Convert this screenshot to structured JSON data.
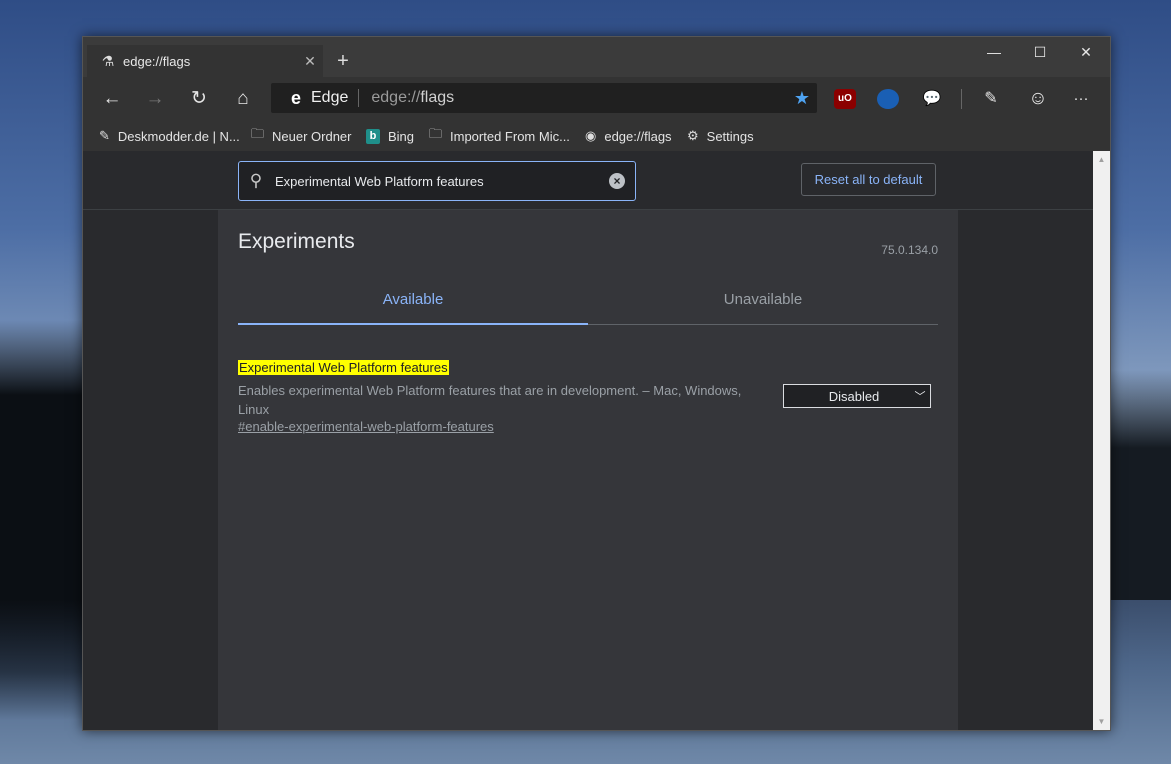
{
  "tab": {
    "title": "edge://flags",
    "close": "✕",
    "new_tab": "+"
  },
  "window_controls": {
    "minimize": "—",
    "maximize": "☐",
    "close": "✕"
  },
  "toolbar": {
    "back": "←",
    "forward": "→",
    "refresh": "↻",
    "home": "⌂",
    "brand": "Edge",
    "url_scheme": "edge://",
    "url_path": "flags",
    "favorite": "★",
    "ext_ublock": "uO",
    "pen": "✎",
    "emoji": "☺",
    "more": "···"
  },
  "bookmarks": [
    {
      "label": "Deskmodder.de | N...",
      "icon": "pen-icon"
    },
    {
      "label": "Neuer Ordner",
      "icon": "folder-icon"
    },
    {
      "label": "Bing",
      "icon": "bing-icon"
    },
    {
      "label": "Imported From Mic...",
      "icon": "folder-icon"
    },
    {
      "label": "edge://flags",
      "icon": "globe-icon"
    },
    {
      "label": "Settings",
      "icon": "gear-icon"
    }
  ],
  "search": {
    "value": "Experimental Web Platform features"
  },
  "reset_label": "Reset all to default",
  "experiments": {
    "title": "Experiments",
    "version": "75.0.134.0",
    "tabs": {
      "available": "Available",
      "unavailable": "Unavailable"
    }
  },
  "flag": {
    "name": "Experimental Web Platform features",
    "description": "Enables experimental Web Platform features that are in development. – Mac, Windows, Linux",
    "link": "#enable-experimental-web-platform-features",
    "selected": "Disabled"
  },
  "colors": {
    "accent": "#8ab4f8",
    "highlight": "#ffff00",
    "background": "#292a2d",
    "panel": "#35363a"
  }
}
